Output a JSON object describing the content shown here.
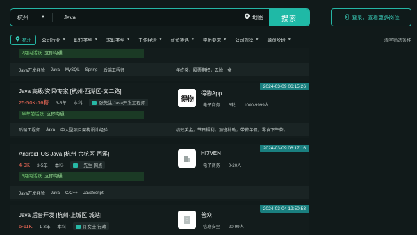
{
  "search": {
    "city": "杭州",
    "query": "Java",
    "map_label": "地图",
    "button_label": "搜索"
  },
  "login_label": "登录，查看更多岗位",
  "filters": {
    "city_chip": "杭州",
    "items": [
      "公司行业",
      "职位类型",
      "求职类型",
      "工作经验",
      "薪资待遇",
      "学历要求",
      "公司规模",
      "融资阶段"
    ],
    "clear_label": "清空筛选条件"
  },
  "jobs": [
    {
      "active": "2月内活跃",
      "contact": "立即沟通",
      "tags": [
        "Java开发经验",
        "Java",
        "MySQL",
        "Spring",
        "后端工程师"
      ],
      "welfare": "年终奖，股票期权，五险一金"
    },
    {
      "title": "Java 高级/资深/专家  [杭州·西湖区·文二路]",
      "salary": "25-50K·16薪",
      "exp": "3-5年",
      "edu": "本科",
      "recruiter": "张先生  Java开发工程师",
      "active": "半年前活跃",
      "contact": "立即沟通",
      "date": "2024-03-09 06:15:26",
      "company": {
        "logo": "得物",
        "name": "得物App",
        "industry": "电子商务",
        "stage": "B轮",
        "size": "1000-9999人"
      },
      "tags": [
        "后端工程师",
        "Java",
        "中大型项目架构设计经验"
      ],
      "welfare": "绩效奖金，节日福利，加班补助，带薪年假，零食下午茶，..."
    },
    {
      "title": "Android iOS Java  [杭州·余杭区·西溪]",
      "salary": "4-9K",
      "exp": "3-5年",
      "edu": "本科",
      "recruiter": "H先生  网点",
      "active": "5月内活跃",
      "contact": "立即沟通",
      "date": "2024-03-09 06:17:16",
      "company": {
        "logo": "",
        "name": "HI7VEN",
        "industry": "电子商务",
        "stage": "",
        "size": "0-20人"
      },
      "tags": [
        "Java开发经验",
        "Java",
        "C/C++",
        "JavaScript"
      ],
      "welfare": ""
    },
    {
      "title": "Java 后台开发  [杭州·上城区·城站]",
      "salary": "6-11K",
      "exp": "1-3年",
      "edu": "本科",
      "recruiter": "许女士  行政",
      "date": "2024-03-04 19:50:53",
      "company": {
        "logo": "",
        "name": "普众",
        "industry": "信息安全",
        "stage": "",
        "size": "20-99人"
      }
    }
  ],
  "colors": {
    "accent": "#1fb9a6",
    "salary": "#f46a58",
    "active_bg": "#1b3a25",
    "active_text": "#7fd37a",
    "background": "#111a1a"
  }
}
